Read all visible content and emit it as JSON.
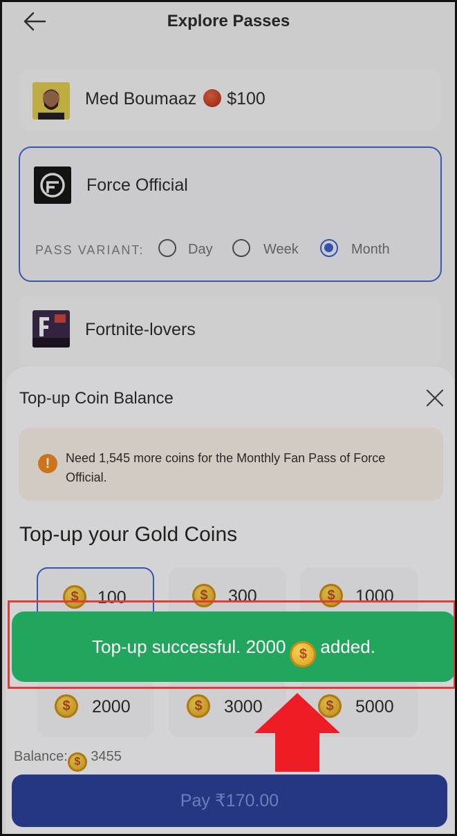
{
  "header": {
    "title": "Explore Passes"
  },
  "passes": [
    {
      "name": "Med Boumaaz",
      "price": "$100"
    },
    {
      "name": "Force Official",
      "variant_label": "PASS VARIANT:",
      "variants": [
        "Day",
        "Week",
        "Month"
      ],
      "selected_variant": "Month"
    },
    {
      "name": "Fortnite-lovers"
    }
  ],
  "sheet": {
    "title": "Top-up Coin Balance",
    "notice": "Need 1,545 more coins for the Monthly Fan Pass of Force Official.",
    "coins_heading": "Top-up your Gold Coins",
    "options": [
      "100",
      "300",
      "1000",
      "2000",
      "3000",
      "5000"
    ],
    "balance_label": "Balance:",
    "balance_value": "3455",
    "pay_label": "Pay ₹170.00"
  },
  "toast": {
    "prefix": "Top-up successful. 2000",
    "suffix": "added."
  },
  "colors": {
    "accent": "#3e63c8",
    "pay_button": "#2b3e96",
    "toast": "#22a55c",
    "highlight": "#e53935"
  },
  "icons": [
    "back-arrow-icon",
    "close-icon",
    "warning-icon",
    "coin-icon",
    "red-arrow-icon"
  ]
}
